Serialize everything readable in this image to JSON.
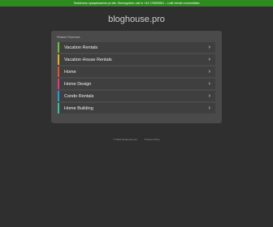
{
  "banner": {
    "text": "Tavbiemos npaqaboaeme po tab. Slonmgobes: call m +44 170805551 – Unik Vende ronomoblato",
    "color": "#2e8b1f"
  },
  "site": {
    "domain": "bloghouse.pro"
  },
  "links_panel": {
    "heading": "Related Searches",
    "items": [
      {
        "label": "Vacation Rentals",
        "accent": "#6fbf3a"
      },
      {
        "label": "Vacation House Rentals",
        "accent": "#e0b22a"
      },
      {
        "label": "Home",
        "accent": "#e0552a"
      },
      {
        "label": "Home Design",
        "accent": "#e23a7a"
      },
      {
        "label": "Condo Rentals",
        "accent": "#2a9adf"
      },
      {
        "label": "Home Building",
        "accent": "#3ac0a0"
      }
    ],
    "chevron_icon": "chevron-right-icon"
  },
  "footer": {
    "copyright": "© 2024 bloghouse.pro",
    "privacy": "Privacy Policy"
  }
}
